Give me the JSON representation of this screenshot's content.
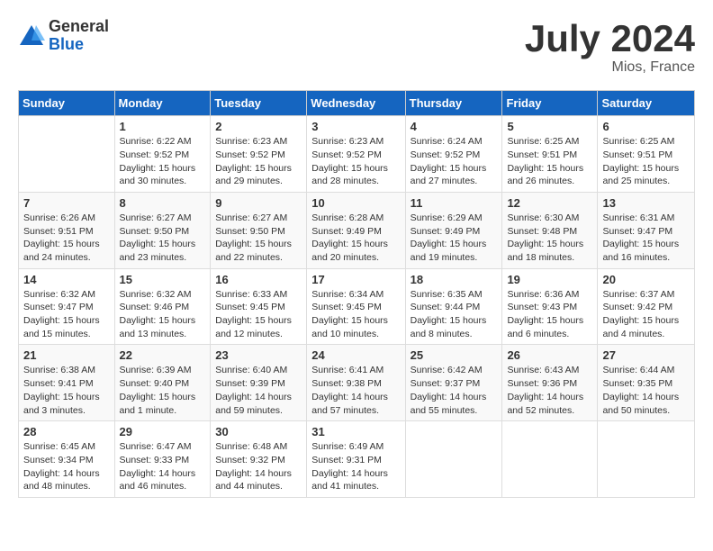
{
  "header": {
    "logo_general": "General",
    "logo_blue": "Blue",
    "month_title": "July 2024",
    "location": "Mios, France"
  },
  "days_of_week": [
    "Sunday",
    "Monday",
    "Tuesday",
    "Wednesday",
    "Thursday",
    "Friday",
    "Saturday"
  ],
  "weeks": [
    [
      null,
      {
        "num": "1",
        "sunrise": "6:22 AM",
        "sunset": "9:52 PM",
        "daylight": "15 hours and 30 minutes."
      },
      {
        "num": "2",
        "sunrise": "6:23 AM",
        "sunset": "9:52 PM",
        "daylight": "15 hours and 29 minutes."
      },
      {
        "num": "3",
        "sunrise": "6:23 AM",
        "sunset": "9:52 PM",
        "daylight": "15 hours and 28 minutes."
      },
      {
        "num": "4",
        "sunrise": "6:24 AM",
        "sunset": "9:52 PM",
        "daylight": "15 hours and 27 minutes."
      },
      {
        "num": "5",
        "sunrise": "6:25 AM",
        "sunset": "9:51 PM",
        "daylight": "15 hours and 26 minutes."
      },
      {
        "num": "6",
        "sunrise": "6:25 AM",
        "sunset": "9:51 PM",
        "daylight": "15 hours and 25 minutes."
      }
    ],
    [
      {
        "num": "7",
        "sunrise": "6:26 AM",
        "sunset": "9:51 PM",
        "daylight": "15 hours and 24 minutes."
      },
      {
        "num": "8",
        "sunrise": "6:27 AM",
        "sunset": "9:50 PM",
        "daylight": "15 hours and 23 minutes."
      },
      {
        "num": "9",
        "sunrise": "6:27 AM",
        "sunset": "9:50 PM",
        "daylight": "15 hours and 22 minutes."
      },
      {
        "num": "10",
        "sunrise": "6:28 AM",
        "sunset": "9:49 PM",
        "daylight": "15 hours and 20 minutes."
      },
      {
        "num": "11",
        "sunrise": "6:29 AM",
        "sunset": "9:49 PM",
        "daylight": "15 hours and 19 minutes."
      },
      {
        "num": "12",
        "sunrise": "6:30 AM",
        "sunset": "9:48 PM",
        "daylight": "15 hours and 18 minutes."
      },
      {
        "num": "13",
        "sunrise": "6:31 AM",
        "sunset": "9:47 PM",
        "daylight": "15 hours and 16 minutes."
      }
    ],
    [
      {
        "num": "14",
        "sunrise": "6:32 AM",
        "sunset": "9:47 PM",
        "daylight": "15 hours and 15 minutes."
      },
      {
        "num": "15",
        "sunrise": "6:32 AM",
        "sunset": "9:46 PM",
        "daylight": "15 hours and 13 minutes."
      },
      {
        "num": "16",
        "sunrise": "6:33 AM",
        "sunset": "9:45 PM",
        "daylight": "15 hours and 12 minutes."
      },
      {
        "num": "17",
        "sunrise": "6:34 AM",
        "sunset": "9:45 PM",
        "daylight": "15 hours and 10 minutes."
      },
      {
        "num": "18",
        "sunrise": "6:35 AM",
        "sunset": "9:44 PM",
        "daylight": "15 hours and 8 minutes."
      },
      {
        "num": "19",
        "sunrise": "6:36 AM",
        "sunset": "9:43 PM",
        "daylight": "15 hours and 6 minutes."
      },
      {
        "num": "20",
        "sunrise": "6:37 AM",
        "sunset": "9:42 PM",
        "daylight": "15 hours and 4 minutes."
      }
    ],
    [
      {
        "num": "21",
        "sunrise": "6:38 AM",
        "sunset": "9:41 PM",
        "daylight": "15 hours and 3 minutes."
      },
      {
        "num": "22",
        "sunrise": "6:39 AM",
        "sunset": "9:40 PM",
        "daylight": "15 hours and 1 minute."
      },
      {
        "num": "23",
        "sunrise": "6:40 AM",
        "sunset": "9:39 PM",
        "daylight": "14 hours and 59 minutes."
      },
      {
        "num": "24",
        "sunrise": "6:41 AM",
        "sunset": "9:38 PM",
        "daylight": "14 hours and 57 minutes."
      },
      {
        "num": "25",
        "sunrise": "6:42 AM",
        "sunset": "9:37 PM",
        "daylight": "14 hours and 55 minutes."
      },
      {
        "num": "26",
        "sunrise": "6:43 AM",
        "sunset": "9:36 PM",
        "daylight": "14 hours and 52 minutes."
      },
      {
        "num": "27",
        "sunrise": "6:44 AM",
        "sunset": "9:35 PM",
        "daylight": "14 hours and 50 minutes."
      }
    ],
    [
      {
        "num": "28",
        "sunrise": "6:45 AM",
        "sunset": "9:34 PM",
        "daylight": "14 hours and 48 minutes."
      },
      {
        "num": "29",
        "sunrise": "6:47 AM",
        "sunset": "9:33 PM",
        "daylight": "14 hours and 46 minutes."
      },
      {
        "num": "30",
        "sunrise": "6:48 AM",
        "sunset": "9:32 PM",
        "daylight": "14 hours and 44 minutes."
      },
      {
        "num": "31",
        "sunrise": "6:49 AM",
        "sunset": "9:31 PM",
        "daylight": "14 hours and 41 minutes."
      },
      null,
      null,
      null
    ]
  ]
}
